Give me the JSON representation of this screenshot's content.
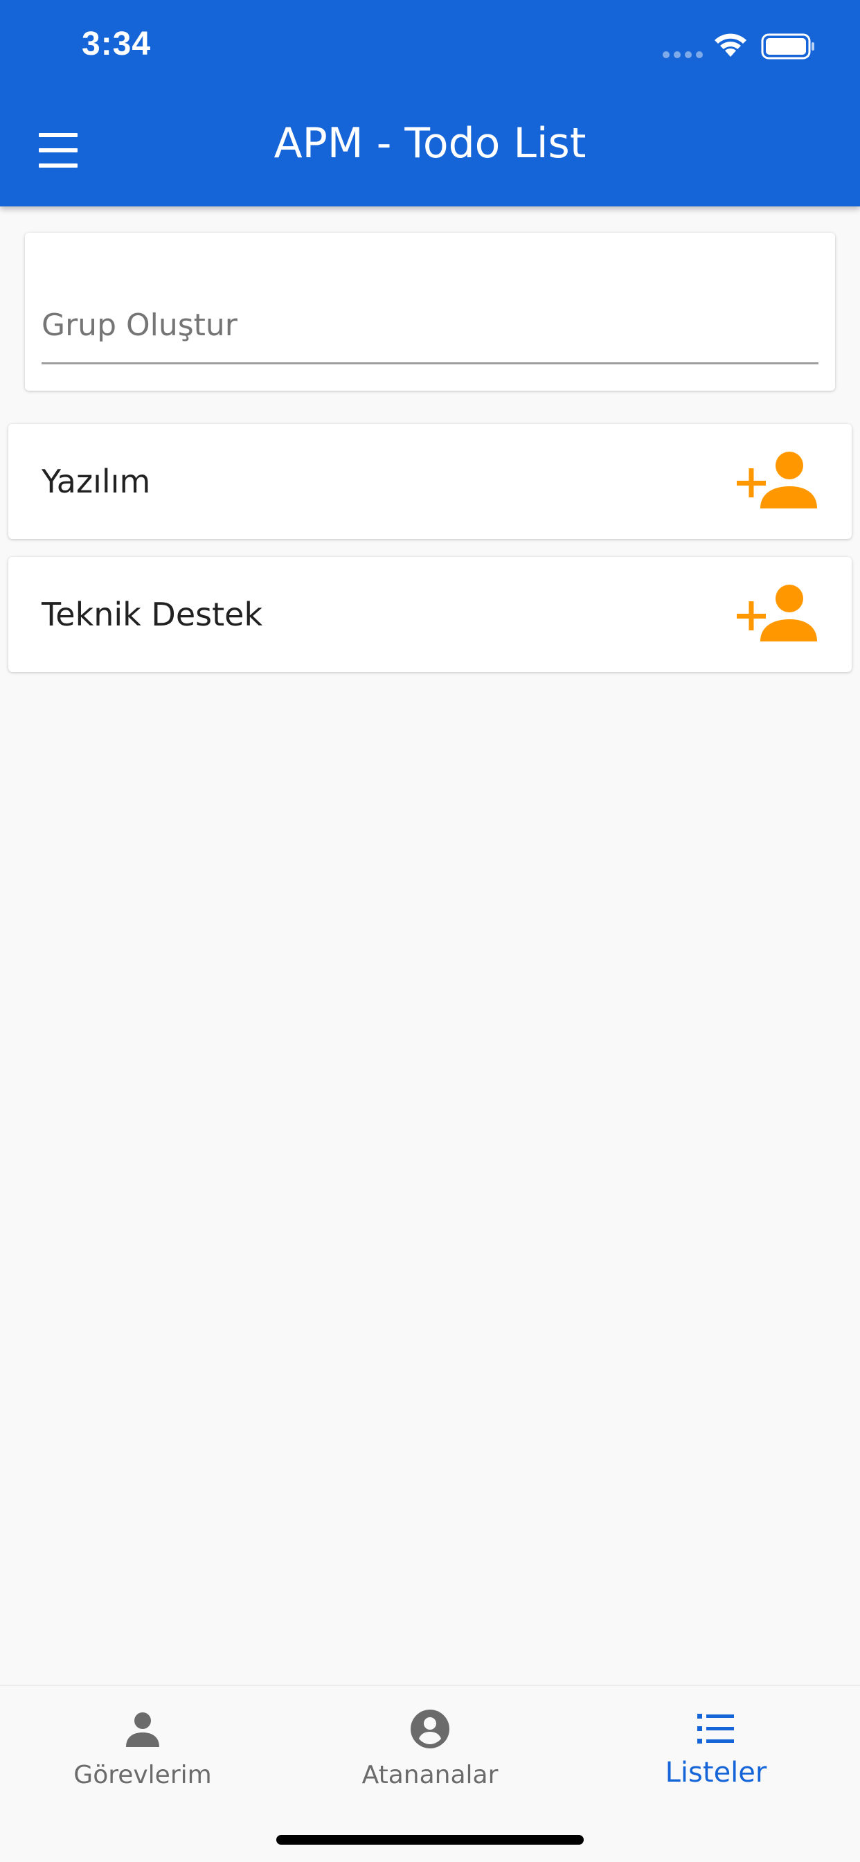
{
  "status_bar": {
    "time": "3:34"
  },
  "header": {
    "title": "APM - Todo List",
    "menu_icon": "hamburger-menu-icon"
  },
  "group_create": {
    "placeholder": "Grup Oluştur",
    "value": ""
  },
  "groups": [
    {
      "label": "Yazılım",
      "action_icon": "add-person-icon"
    },
    {
      "label": "Teknik Destek",
      "action_icon": "add-person-icon"
    }
  ],
  "bottom_nav": {
    "items": [
      {
        "label": "Görevlerim",
        "icon": "person-icon",
        "active": false
      },
      {
        "label": "Atananalar",
        "icon": "account-circle-icon",
        "active": false
      },
      {
        "label": "Listeler",
        "icon": "list-icon",
        "active": true
      }
    ]
  },
  "colors": {
    "primary": "#1565d8",
    "accent": "#ff9800",
    "background": "#f9f9f9",
    "inactive_nav": "#6b6b6b"
  }
}
